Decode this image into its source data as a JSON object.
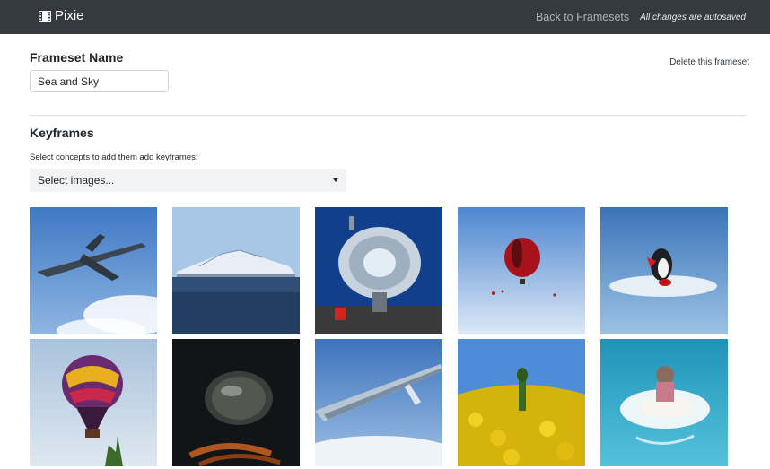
{
  "navbar": {
    "brand": "Pixie",
    "brand_icon": "film-icon",
    "back_link": "Back to Framesets",
    "autosave_note": "All changes are autosaved"
  },
  "frameset": {
    "name_label": "Frameset Name",
    "name_value": "Sea and Sky",
    "delete_label": "Delete this frameset"
  },
  "keyframes": {
    "heading": "Keyframes",
    "hint": "Select concepts to add them add keyframes:",
    "select_placeholder": "Select images...",
    "images": [
      {
        "subject": "jet-over-clouds"
      },
      {
        "subject": "pier-over-sea"
      },
      {
        "subject": "solar-reflector"
      },
      {
        "subject": "red-hot-air-balloon"
      },
      {
        "subject": "penguin-figure"
      },
      {
        "subject": "patterned-hot-air-balloon"
      },
      {
        "subject": "glass-lens"
      },
      {
        "subject": "aircraft-wing"
      },
      {
        "subject": "yellow-flower-field"
      },
      {
        "subject": "child-in-water"
      }
    ]
  },
  "colors": {
    "navbar_bg": "#343a40",
    "select_bg": "#f1f3f5"
  }
}
